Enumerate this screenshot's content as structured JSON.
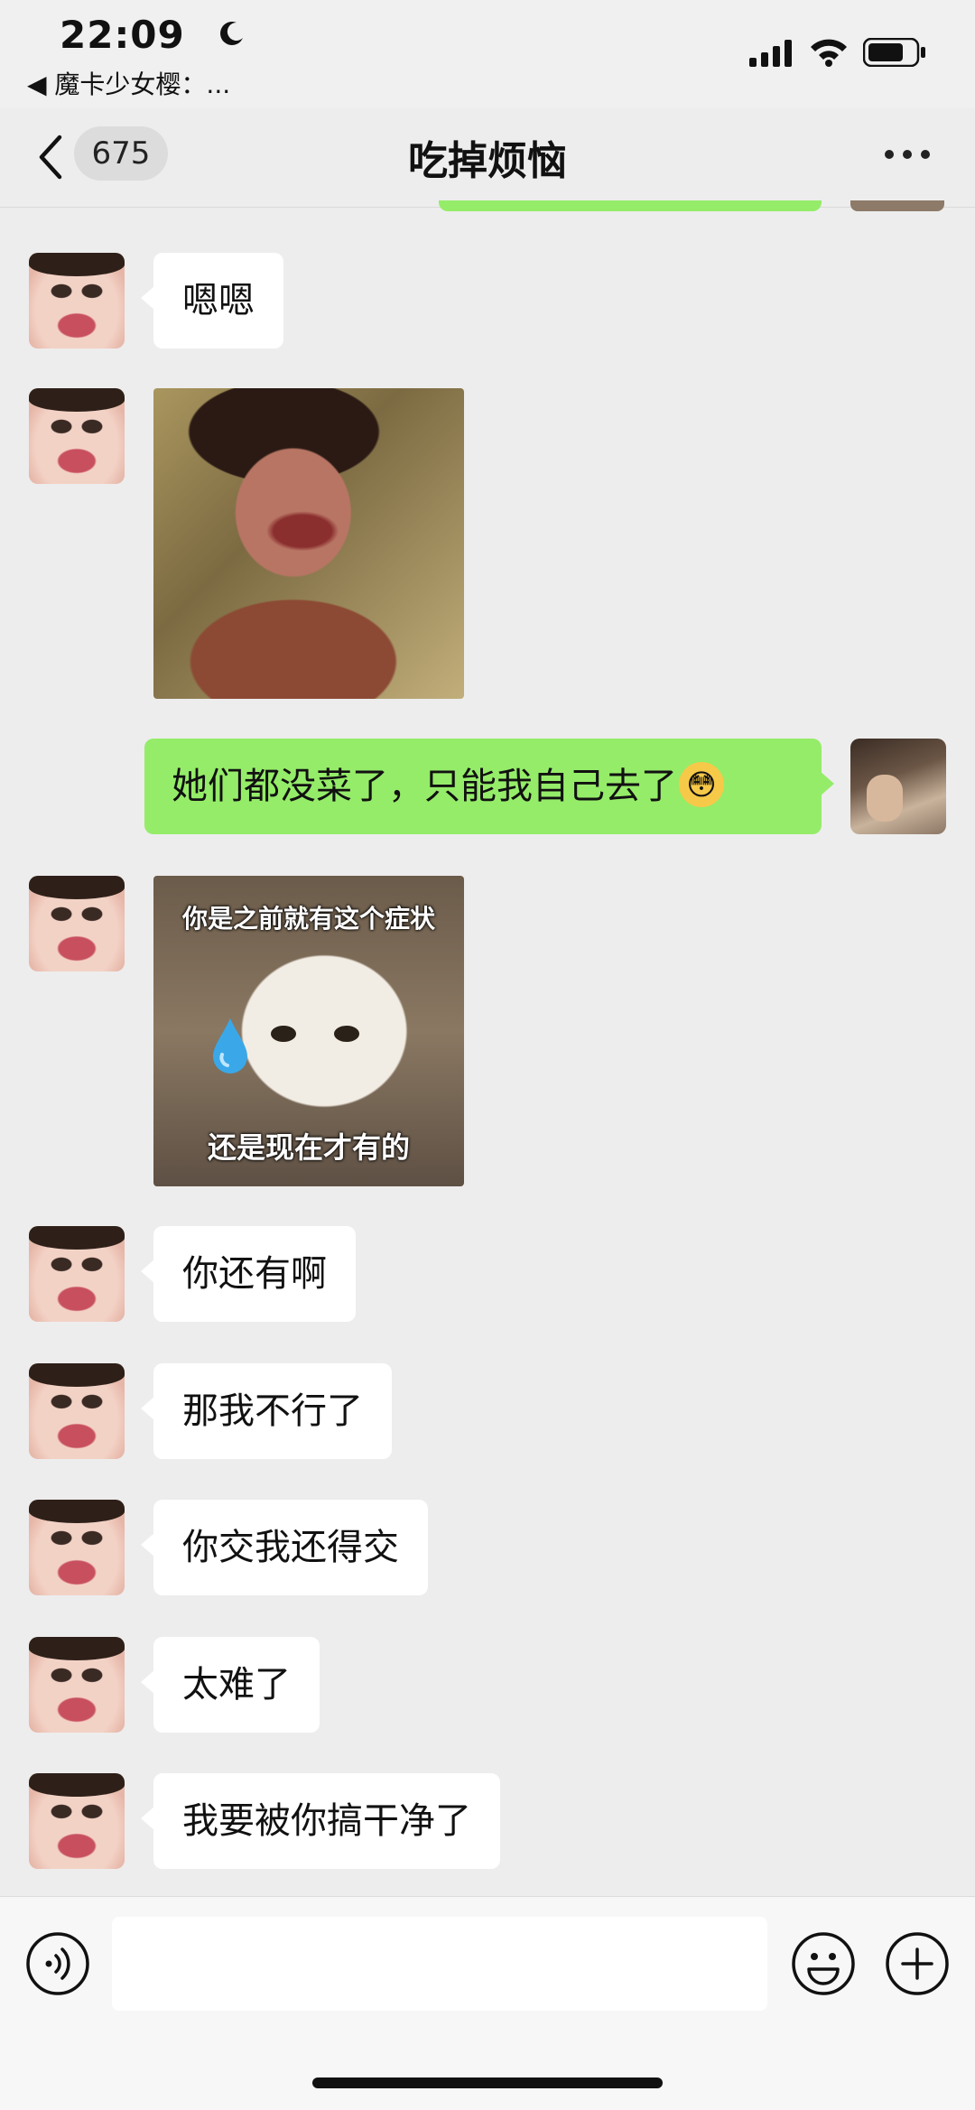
{
  "status_bar": {
    "time": "22:09",
    "back_app": "◀ 魔卡少女樱：..."
  },
  "nav": {
    "unread_count": "675",
    "title": "吃掉烦恼"
  },
  "messages": [
    {
      "side": "left",
      "type": "text",
      "text": "嗯嗯"
    },
    {
      "side": "left",
      "type": "sticker",
      "sticker": "girl-photo"
    },
    {
      "side": "right",
      "type": "text",
      "text": "她们都没菜了，只能我自己去了",
      "emoji": "flushed-face-emoji"
    },
    {
      "side": "left",
      "type": "sticker",
      "sticker": "cat-photo",
      "top_text": "你是之前就有这个症状",
      "bottom_text": "还是现在才有的"
    },
    {
      "side": "left",
      "type": "text",
      "text": "你还有啊"
    },
    {
      "side": "left",
      "type": "text",
      "text": "那我不行了"
    },
    {
      "side": "left",
      "type": "text",
      "text": "你交我还得交"
    },
    {
      "side": "left",
      "type": "text",
      "text": "太难了"
    },
    {
      "side": "left",
      "type": "text",
      "text": "我要被你搞干净了"
    }
  ],
  "input": {
    "value": "",
    "placeholder": ""
  },
  "colors": {
    "background": "#ededed",
    "self_bubble": "#95ec69",
    "other_bubble": "#ffffff"
  },
  "icons": [
    "moon-icon",
    "signal-icon",
    "wifi-icon",
    "battery-icon",
    "back-chevron-icon",
    "more-icon",
    "voice-icon",
    "emoji-icon",
    "plus-icon"
  ]
}
